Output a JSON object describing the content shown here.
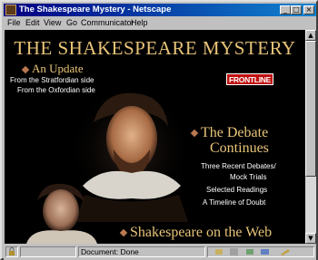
{
  "window": {
    "title": "The Shakespeare Mystery - Netscape",
    "controls": {
      "minimize": "_",
      "maximize": "□",
      "close": "×"
    }
  },
  "menu": {
    "items": [
      {
        "label": "File"
      },
      {
        "label": "Edit"
      },
      {
        "label": "View"
      },
      {
        "label": "Go"
      },
      {
        "label": "Communicator"
      },
      {
        "label": "Help"
      }
    ]
  },
  "page": {
    "title": "THE SHAKESPEARE MYSTERY",
    "update": {
      "heading": "An Update",
      "links": [
        "From the Stratfordian side",
        "From the Oxfordian side"
      ]
    },
    "badge": "FRONTLINE",
    "debate": {
      "heading_line1": "The Debate",
      "heading_line2": "Continues",
      "links": [
        "Three Recent Debates/",
        "Mock Trials",
        "Selected Readings",
        "A Timeline of Doubt"
      ]
    },
    "web_heading": "Shakespeare on the Web"
  },
  "status": {
    "text": "Document: Done"
  },
  "colors": {
    "title_gold": "#e8c478",
    "bullet": "#b87850",
    "titlebar": "#000080",
    "badge_red": "#c01010"
  }
}
